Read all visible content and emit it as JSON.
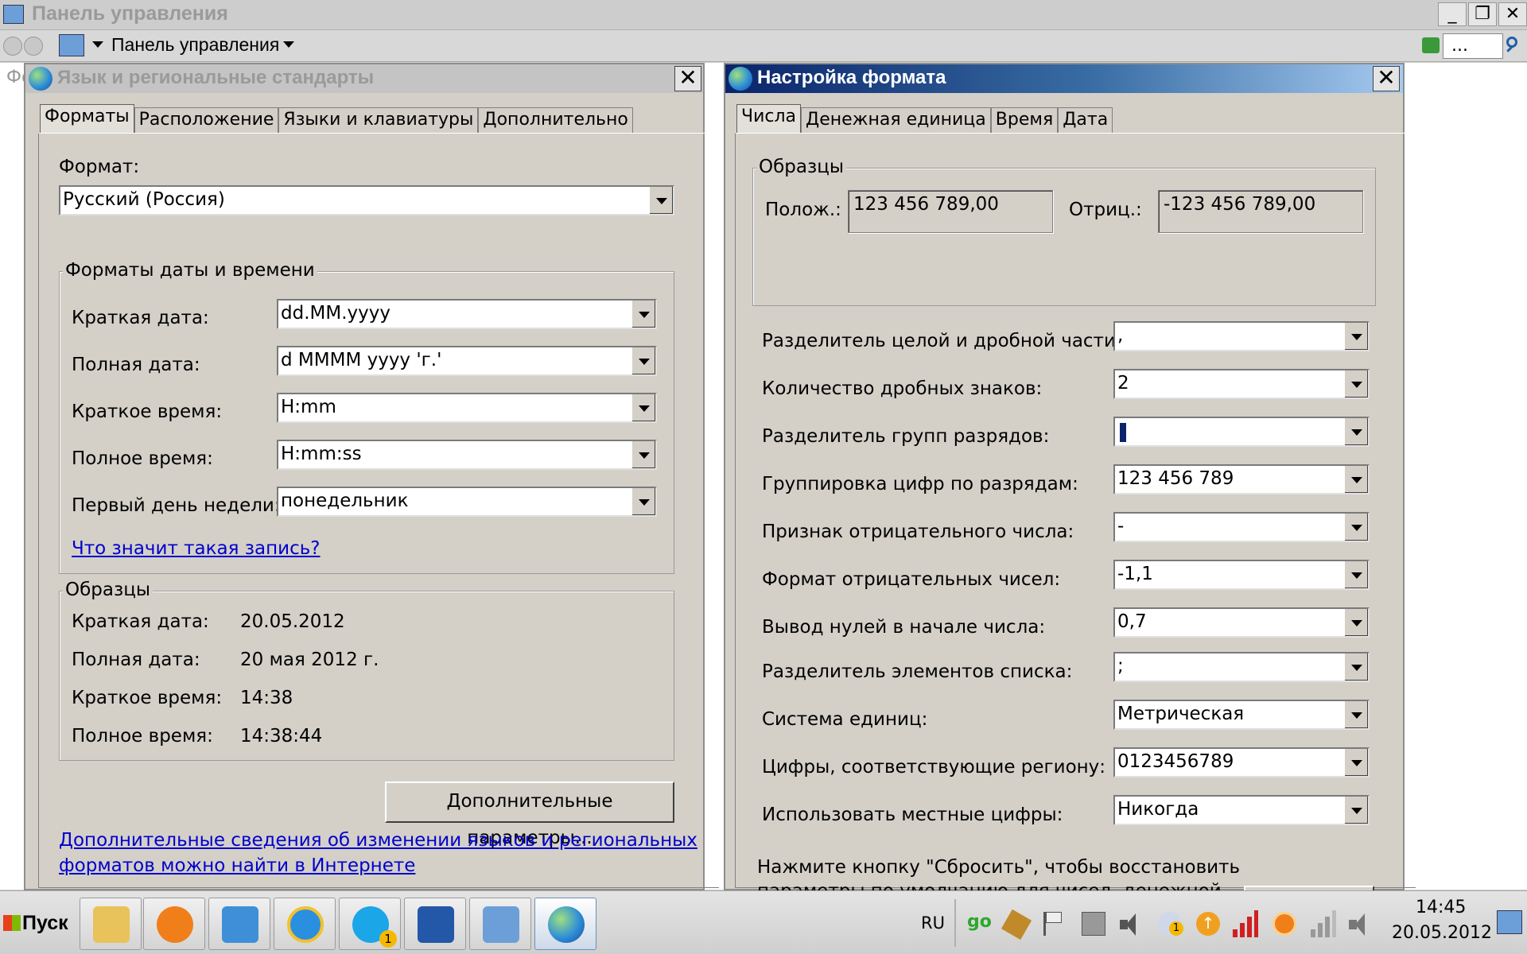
{
  "control_panel": {
    "title": "Панель управления",
    "address_label": "Панель управления",
    "search_placeholder": "...",
    "behind_text": "Фо"
  },
  "regional_dialog": {
    "title": "Язык и региональные стандарты",
    "tabs": [
      "Форматы",
      "Расположение",
      "Языки и клавиатуры",
      "Дополнительно"
    ],
    "format_label": "Формат:",
    "format_value": "Русский (Россия)",
    "datetime_group_title": "Форматы даты и времени",
    "fields": [
      {
        "label": "Краткая дата:",
        "value": "dd.MM.yyyy"
      },
      {
        "label": "Полная дата:",
        "value": "d MMMM yyyy 'г.'"
      },
      {
        "label": "Краткое время:",
        "value": "H:mm"
      },
      {
        "label": "Полное время:",
        "value": "H:mm:ss"
      },
      {
        "label": "Первый день недели:",
        "value": "понедельник"
      }
    ],
    "help_link": "Что значит такая запись?",
    "samples_group_title": "Образцы",
    "samples": [
      {
        "label": "Краткая дата:",
        "value": "20.05.2012"
      },
      {
        "label": "Полная дата:",
        "value": "20 мая 2012 г."
      },
      {
        "label": "Краткое время:",
        "value": "14:38"
      },
      {
        "label": "Полное время:",
        "value": "14:38:44"
      }
    ],
    "advanced_button": "Дополнительные параметры...",
    "info_link_line1": "Дополнительные сведения об изменении языков и региональных",
    "info_link_line2": "форматов можно найти в Интернете"
  },
  "format_dialog": {
    "title": "Настройка формата",
    "tabs": [
      "Числа",
      "Денежная единица",
      "Время",
      "Дата"
    ],
    "samples_group_title": "Образцы",
    "positive_label": "Полож.:",
    "positive_value": "123 456 789,00",
    "negative_label": "Отриц.:",
    "negative_value": "-123 456 789,00",
    "fields": [
      {
        "label": "Разделитель целой и дробной части:",
        "value": ","
      },
      {
        "label": "Количество дробных знаков:",
        "value": "2"
      },
      {
        "label": "Разделитель групп разрядов:",
        "value": ""
      },
      {
        "label": "Группировка цифр по разрядам:",
        "value": "123 456 789"
      },
      {
        "label": "Признак отрицательного числа:",
        "value": "-"
      },
      {
        "label": "Формат отрицательных чисел:",
        "value": "-1,1"
      },
      {
        "label": "Вывод нулей в начале числа:",
        "value": "0,7"
      },
      {
        "label": "Разделитель элементов списка:",
        "value": ";"
      },
      {
        "label": "Система единиц:",
        "value": "Метрическая"
      },
      {
        "label": "Цифры, соответствующие региону:",
        "value": "0123456789"
      },
      {
        "label": "Использовать местные цифры:",
        "value": "Никогда"
      }
    ],
    "reset_note_line1": "Нажмите кнопку \"Сбросить\", чтобы восстановить",
    "reset_note_line2": "параметры по умолчанию для чисел, денежной"
  },
  "taskbar": {
    "start_label": "Пуск",
    "language": "RU",
    "time": "14:45",
    "date": "20.05.2012",
    "apps": [
      "explorer",
      "media-player",
      "mail",
      "internet-explorer",
      "skype",
      "word",
      "control-panel",
      "regional-settings"
    ],
    "skype_badge": "1",
    "tray_badge": "1",
    "tray_go_label": "go"
  },
  "colors": {
    "dialog_bg": "#d4d0c8",
    "active_title_start": "#0a246a",
    "active_title_end": "#a6caf0",
    "link": "#0000cc"
  }
}
